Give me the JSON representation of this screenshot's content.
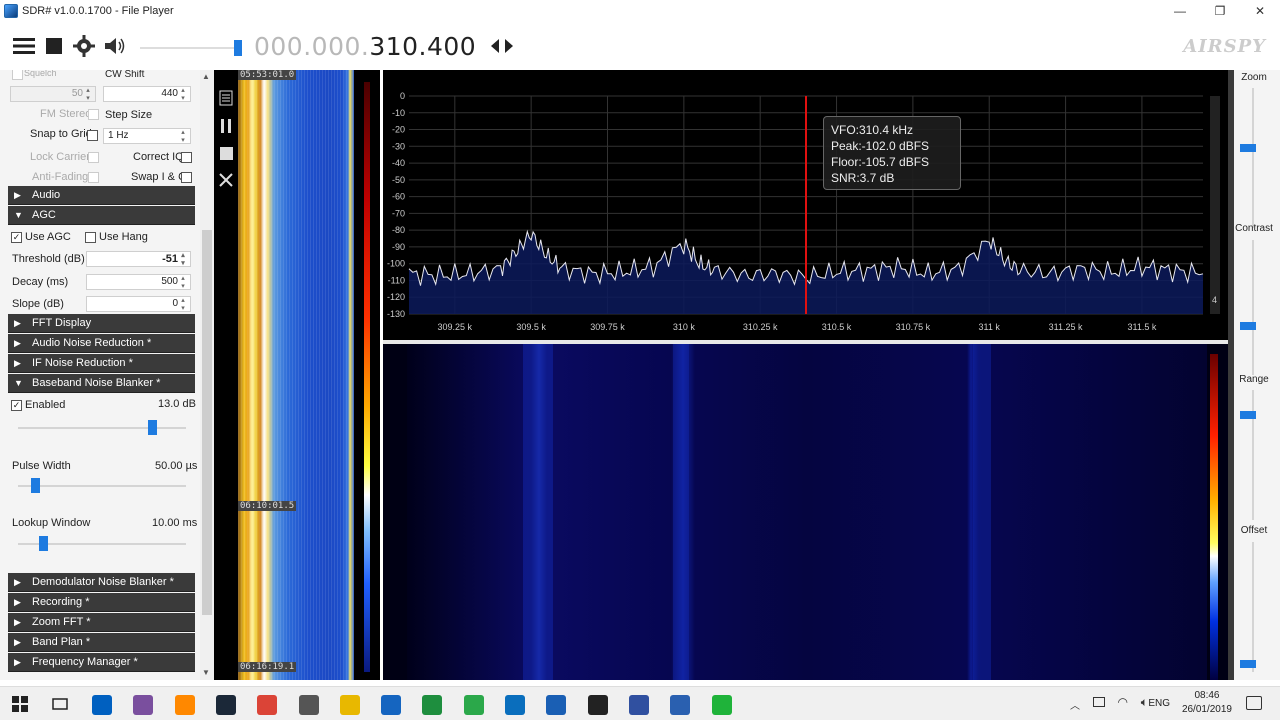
{
  "window": {
    "title": "SDR# v1.0.0.1700 - File Player",
    "minimize_icon": "minimize-icon",
    "restore_icon": "restore-icon",
    "close_icon": "close-icon"
  },
  "toolbar": {
    "frequency_dim": "000.000.",
    "frequency_bright": "310.400",
    "logo": "AIRSPY"
  },
  "left_panel": {
    "squelch_label": "Squelch",
    "cw_shift_label": "CW Shift",
    "squelch_value": "50",
    "cw_shift_value": "440",
    "fm_stereo_label": "FM Stereo",
    "step_size_label": "Step Size",
    "snap_to_grid_label": "Snap to Grid",
    "step_size_value": "1 Hz",
    "lock_carrier_label": "Lock Carrier",
    "correct_iq_label": "Correct IQ",
    "anti_fading_label": "Anti-Fading",
    "swap_iq_label": "Swap I & Q",
    "sections": {
      "audio": "Audio",
      "agc": "AGC",
      "fft_display": "FFT Display",
      "audio_nr": "Audio Noise Reduction *",
      "if_nr": "IF Noise Reduction *",
      "baseband_nb": "Baseband Noise Blanker *",
      "demod_nb": "Demodulator Noise Blanker *",
      "recording": "Recording *",
      "zoom_fft": "Zoom FFT *",
      "band_plan": "Band Plan *",
      "freq_manager": "Frequency Manager *"
    },
    "agc": {
      "use_agc_label": "Use AGC",
      "use_hang_label": "Use Hang",
      "threshold_label": "Threshold (dB)",
      "threshold_value": "-51",
      "decay_label": "Decay (ms)",
      "decay_value": "500",
      "slope_label": "Slope (dB)",
      "slope_value": "0"
    },
    "nb": {
      "enabled_label": "Enabled",
      "enabled_value": "13.0 dB",
      "enabled_level": 0.8,
      "pulse_width_label": "Pulse Width",
      "pulse_width_value": "50.00 µs",
      "pulse_width_level": 0.1,
      "lookup_window_label": "Lookup Window",
      "lookup_window_value": "10.00 ms",
      "lookup_window_level": 0.15
    }
  },
  "slow_waterfall": {
    "time_top": "05:53:01.0",
    "time_mid": "06:10:01.5",
    "time_bottom": "06:16:19.1"
  },
  "spectrum": {
    "y_ticks": [
      "0",
      "-10",
      "-20",
      "-30",
      "-40",
      "-50",
      "-60",
      "-70",
      "-80",
      "-90",
      "-100",
      "-110",
      "-120",
      "-130"
    ],
    "x_ticks": [
      "309.25 k",
      "309.5 k",
      "309.75 k",
      "310 k",
      "310.25 k",
      "310.5 k",
      "310.75 k",
      "311 k",
      "311.25 k",
      "311.5 k"
    ],
    "tooltip": {
      "vfo": "VFO:310.4 kHz",
      "peak": "Peak:-102.0 dBFS",
      "floor": "Floor:-105.7 dBFS",
      "snr": "SNR:3.7 dB"
    },
    "right_badge": "4"
  },
  "chart_data": {
    "type": "line",
    "xlabel": "",
    "ylabel": "",
    "xlim": [
      309.1,
      311.7
    ],
    "ylim": [
      -130,
      0
    ],
    "x": [
      309.1,
      309.2,
      309.3,
      309.4,
      309.45,
      309.5,
      309.55,
      309.6,
      309.7,
      309.8,
      309.9,
      310.0,
      310.05,
      310.1,
      310.2,
      310.3,
      310.4,
      310.5,
      310.6,
      310.7,
      310.8,
      310.9,
      311.0,
      311.05,
      311.1,
      311.2,
      311.3,
      311.4,
      311.5,
      311.6,
      311.7
    ],
    "series": [
      {
        "values": [
          -106,
          -107,
          -106,
          -103,
          -93,
          -82,
          -95,
          -103,
          -106,
          -105,
          -102,
          -88,
          -100,
          -104,
          -107,
          -106,
          -108,
          -105,
          -104,
          -102,
          -106,
          -103,
          -86,
          -98,
          -104,
          -106,
          -103,
          -105,
          -102,
          -104,
          -106
        ]
      }
    ],
    "vfo_x": 310.4
  },
  "right_panel": {
    "zoom_label": "Zoom",
    "contrast_label": "Contrast",
    "range_label": "Range",
    "offset_label": "Offset"
  },
  "taskbar": {
    "lang": "ENG",
    "time": "08:46",
    "date": "26/01/2019",
    "colors": [
      "#0078d7",
      "#2b5797",
      "#0060c0",
      "#7a4f9e",
      "#ff8800",
      "#1b2838",
      "#db4437",
      "#555",
      "#e8b800",
      "#1565c0",
      "#1e8e3e",
      "#2ba84a",
      "#0a6ebd",
      "#1a5fb4",
      "#222",
      "#3050a0",
      "#2a60b0",
      "#1fb33a"
    ]
  }
}
